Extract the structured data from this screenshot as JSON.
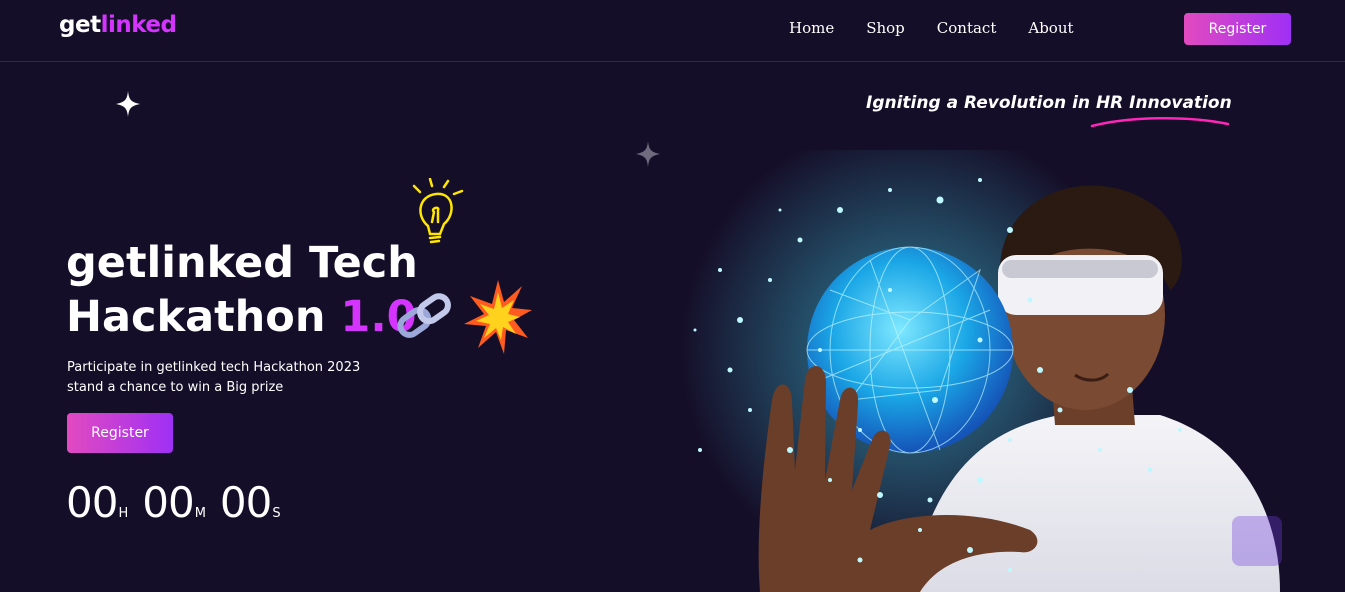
{
  "nav": {
    "logo_part1": "get",
    "logo_part2": "linked",
    "links": [
      "Home",
      "Shop",
      "Contact",
      "About"
    ],
    "register_label": "Register"
  },
  "tagline": {
    "text_main": "Igniting a Revolution in ",
    "text_highlight": "HR Innovation"
  },
  "hero": {
    "title_line1": "getlinked Tech",
    "title_line2": "Hackathon ",
    "title_version": "1.0",
    "description": "Participate in getlinked tech Hackathon 2023 stand a chance to win a Big prize",
    "register_label": "Register",
    "icons": [
      "lightbulb-icon",
      "chain-icon",
      "burst-icon",
      "sparkle-star-icon"
    ]
  },
  "timer": {
    "hours": "00",
    "hours_unit": "H",
    "minutes": "00",
    "minutes_unit": "M",
    "seconds": "00",
    "seconds_unit": "S"
  },
  "colors": {
    "background": "#150e28",
    "accent_purple": "#d434fe",
    "button_gradient_start": "#e24ac0",
    "button_gradient_end": "#9f30f5",
    "underline_pink": "#ff26b9"
  }
}
